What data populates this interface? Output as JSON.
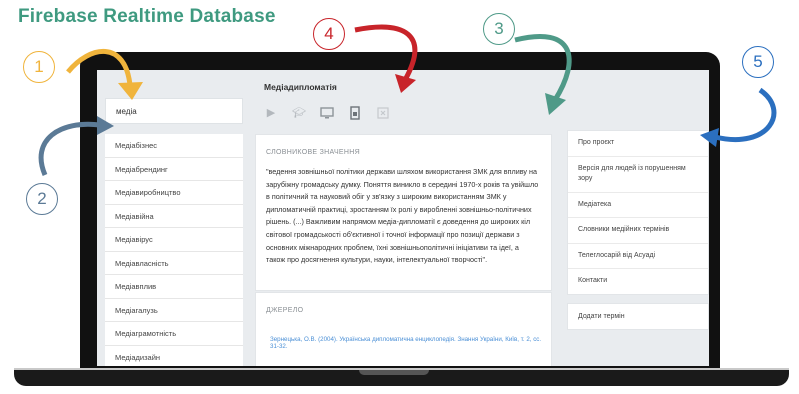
{
  "header": {
    "title": "Firebase Realtime Database"
  },
  "callouts": [
    {
      "label": "1",
      "color": "#f0b43c"
    },
    {
      "label": "2",
      "color": "#5b7a96"
    },
    {
      "label": "3",
      "color": "#4f9a88"
    },
    {
      "label": "4",
      "color": "#c8242a"
    },
    {
      "label": "5",
      "color": "#2b6fbf"
    }
  ],
  "search": {
    "value": "медіа"
  },
  "terms": [
    "Медіабізнес",
    "Медіабрендинг",
    "Медіавиробництво",
    "Медіавійна",
    "Медіавірус",
    "Медіавласність",
    "Медіавплив",
    "Медіагалузь",
    "Медіаграмотність",
    "Медіадизайн"
  ],
  "main": {
    "term_title": "Медіадипломатія",
    "icons": [
      "youtube-icon",
      "graduation-cap-icon",
      "monitor-icon",
      "document-icon",
      "close-square-icon"
    ],
    "definition_heading": "СЛОВНИКОВЕ ЗНАЧЕННЯ",
    "definition_text": "\"ведення зовнішньої політики держави шляхом використання ЗМК для впливу на зарубіжну громадську думку. Поняття виникло в середині 1970-х років та увійшло в політичний та науковий обіг у зв'язку з широким використанням ЗМК у дипломатичній практиці, зростанням їх ролі у виробленні зовнішньо-політичних рішень. (...) Важливим напрямом медіа-дипломатії є доведення до широких кіл світової громадськості об'єктивної і точної інформації про позиції держави з основних міжнародних проблем, їхні зовнішньополітичні ініціативи та ідеї, а також про досягнення культури, науки, інтелектуальної творчості\".",
    "source_heading": "ДЖЕРЕЛО",
    "source_text": "Зернецька, О.В. (2004). Українська дипломатична енциклопедія. Знання України, Київ, т. 2, сс. 31-32."
  },
  "right_menu": [
    "Про проєкт",
    "Версія для людей із порушенням зору",
    "Медіатека",
    "Словники медійних термінів",
    "Телеглосарій від Асуаді",
    "Контакти"
  ],
  "add_term": "Додати термін"
}
